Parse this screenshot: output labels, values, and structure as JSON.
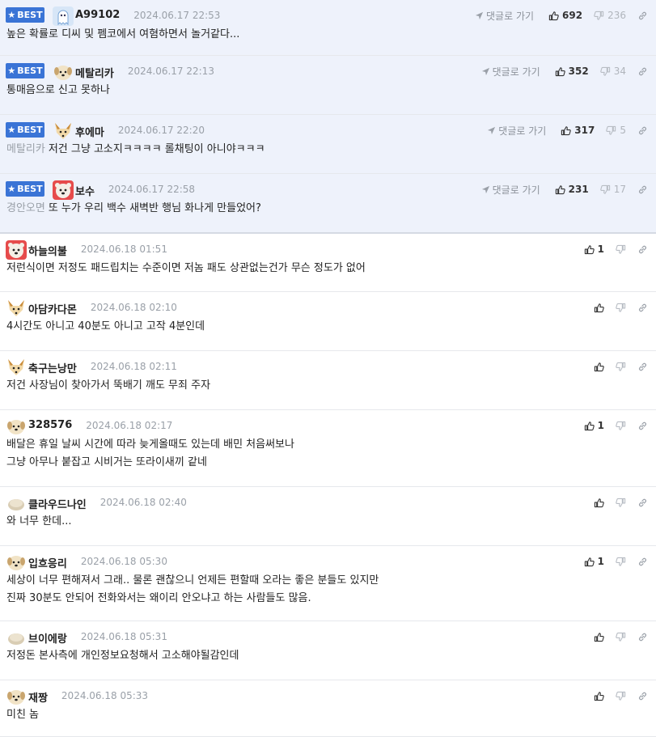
{
  "labels": {
    "best": "BEST",
    "go_reply": "댓글로 가기"
  },
  "colors": {
    "best_bg": "#eef2fb",
    "badge": "#3a74d6",
    "muted": "#9aa0a8"
  },
  "comments": [
    {
      "best": true,
      "nick": "A99102",
      "date": "2024.06.17 22:53",
      "up": "692",
      "down": "236",
      "quote": "",
      "lines": [
        "높은 확률로 디씨 및 펨코에서 여혐하면서 놀거같다..."
      ],
      "avatar": "ghost-avatar"
    },
    {
      "best": true,
      "nick": "메탈리카",
      "date": "2024.06.17 22:13",
      "up": "352",
      "down": "34",
      "quote": "",
      "lines": [
        "통매음으로 신고 못하나"
      ],
      "avatar": "dog-avatar"
    },
    {
      "best": true,
      "nick": "후에마",
      "date": "2024.06.17 22:20",
      "up": "317",
      "down": "5",
      "quote": "메탈리카",
      "lines": [
        "저건 그냥 고소지ㅋㅋㅋㅋ 롤채팅이 아니야ㅋㅋㅋ"
      ],
      "avatar": "fox-avatar"
    },
    {
      "best": true,
      "nick": "보수",
      "date": "2024.06.17 22:58",
      "up": "231",
      "down": "17",
      "quote": "경안오면",
      "lines": [
        "또 누가 우리 백수 새벽반 행님 화나게 만들었어?"
      ],
      "avatar": "bear-avatar"
    },
    {
      "best": false,
      "nick": "하늘의불",
      "date": "2024.06.18 01:51",
      "up": "1",
      "down": "",
      "quote": "",
      "lines": [
        "저런식이면 저정도 패드립치는 수준이면 저놈 패도 상관없는건가 무슨 정도가 없어"
      ],
      "avatar": "bear-avatar"
    },
    {
      "best": false,
      "nick": "아담카다몬",
      "date": "2024.06.18 02:10",
      "up": "",
      "down": "",
      "quote": "",
      "lines": [
        "4시간도 아니고 40분도 아니고 고작 4분인데"
      ],
      "avatar": "fox-avatar"
    },
    {
      "best": false,
      "nick": "축구는낭만",
      "date": "2024.06.18 02:11",
      "up": "",
      "down": "",
      "quote": "",
      "lines": [
        "저건 사장님이 찾아가서 뚝배기 깨도 무죄 주자"
      ],
      "avatar": "fox-avatar"
    },
    {
      "best": false,
      "nick": "328576",
      "date": "2024.06.18 02:17",
      "up": "1",
      "down": "",
      "quote": "",
      "lines": [
        "배달은 휴일 날씨 시간에 따라 늦게올때도 있는데 배민 처음써보나",
        "그냥 아무나 붙잡고 시비거는 또라이새끼 같네"
      ],
      "avatar": "dog-avatar"
    },
    {
      "best": false,
      "nick": "클라우드나인",
      "date": "2024.06.18 02:40",
      "up": "",
      "down": "",
      "quote": "",
      "lines": [
        "와 너무 한데..."
      ],
      "avatar": "egg-avatar"
    },
    {
      "best": false,
      "nick": "입흐응리",
      "date": "2024.06.18 05:30",
      "up": "1",
      "down": "",
      "quote": "",
      "lines": [
        "세상이 너무 편해져서 그래.. 물론 괜찮으니 언제든 편할때 오라는 좋은 분들도 있지만",
        "진짜 30분도 안되어 전화와서는 왜이리 안오냐고 하는 사람들도 많음."
      ],
      "avatar": "dog-avatar"
    },
    {
      "best": false,
      "nick": "브이에랑",
      "date": "2024.06.18 05:31",
      "up": "",
      "down": "",
      "quote": "",
      "lines": [
        "저정돈 본사측에 개인정보요청해서 고소해야될감인데"
      ],
      "avatar": "egg-avatar"
    },
    {
      "best": false,
      "nick": "재짱",
      "date": "2024.06.18 05:33",
      "up": "",
      "down": "",
      "quote": "",
      "lines": [
        "미친 놈"
      ],
      "avatar": "dog-avatar"
    }
  ]
}
